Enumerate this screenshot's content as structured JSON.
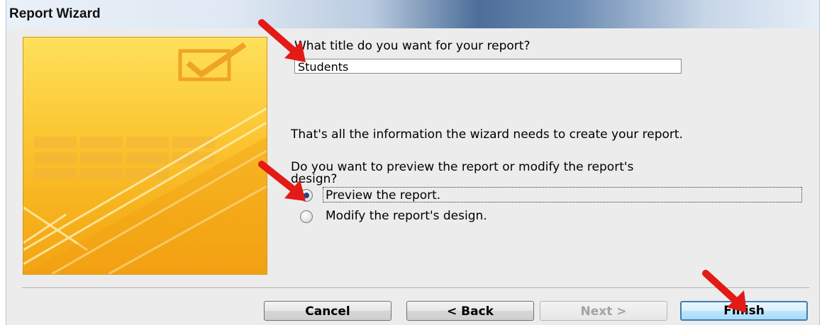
{
  "window": {
    "title": "Report Wizard"
  },
  "form": {
    "title_prompt": "What title do you want for your report?",
    "title_value": "Students",
    "info_text": "That's all the information the wizard needs to create your report.",
    "question_line1": "Do you want to preview the report or modify the report's",
    "question_line2": "design?",
    "options": [
      {
        "label": "Preview the report.",
        "selected": true
      },
      {
        "label": "Modify the report's design.",
        "selected": false
      }
    ]
  },
  "buttons": {
    "cancel": "Cancel",
    "back": "< Back",
    "next": "Next >",
    "finish": "Finish"
  },
  "colors": {
    "annotation_arrow": "#e31a16",
    "banner": "#f9c02c",
    "default_button_border": "#3c7fb1",
    "radio_dot": "#2a3f85"
  }
}
